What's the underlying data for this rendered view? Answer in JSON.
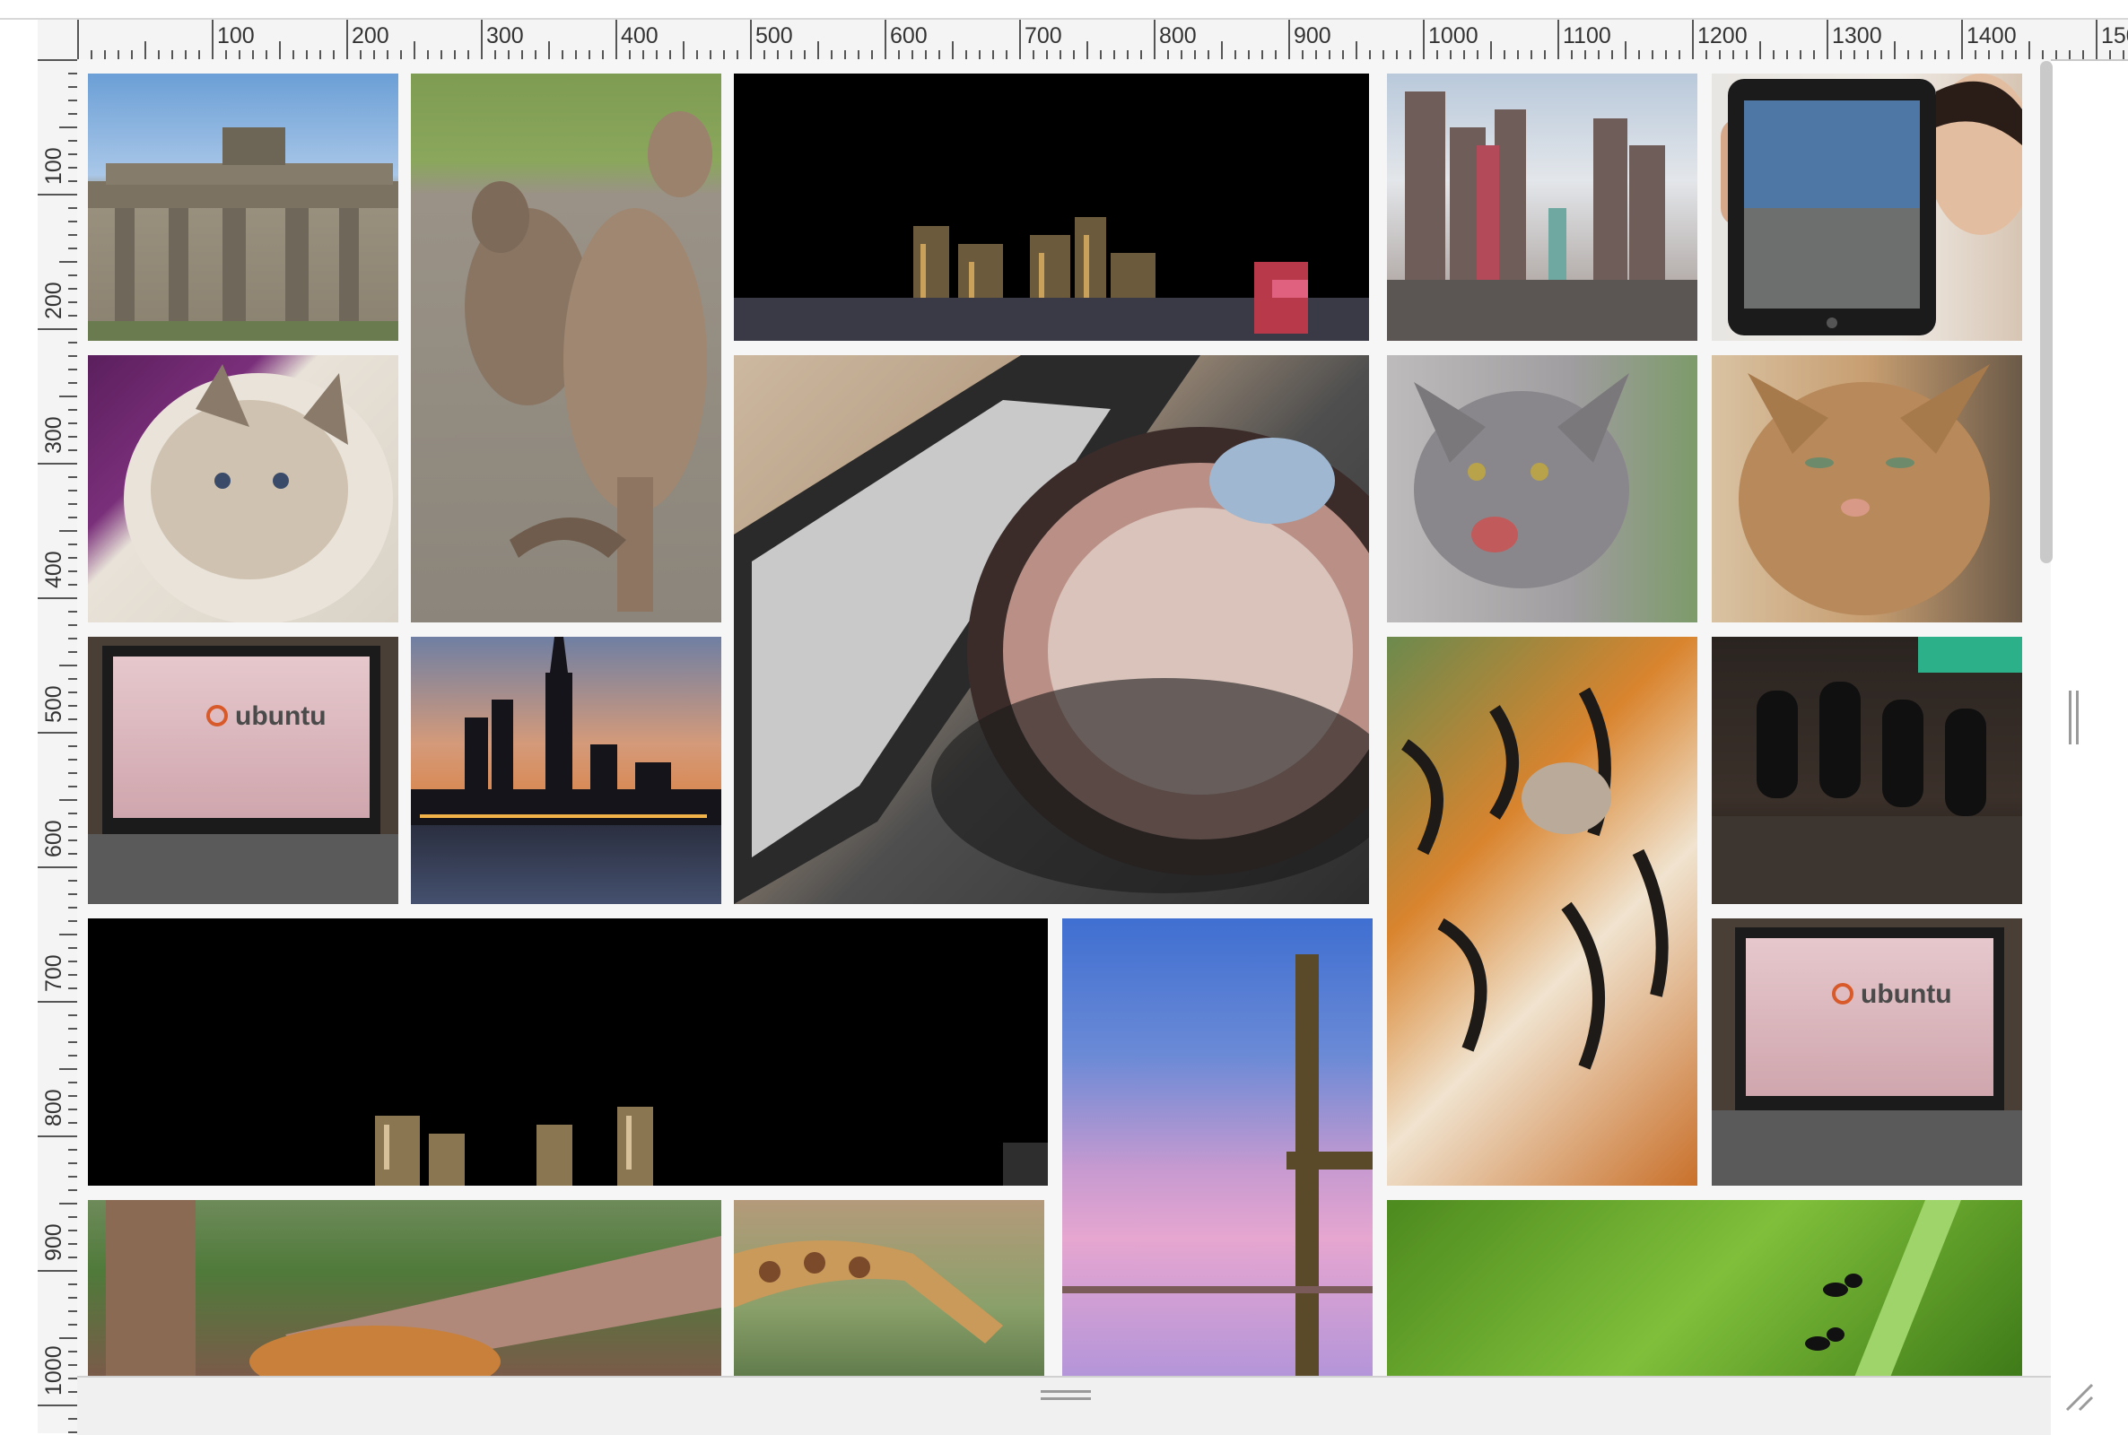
{
  "ruler": {
    "horizontal_labels": [
      "100",
      "200",
      "300",
      "400",
      "500",
      "600",
      "700",
      "800",
      "900",
      "1000",
      "1100",
      "1200",
      "1300",
      "1400",
      "150"
    ],
    "vertical_labels": [
      "100",
      "200",
      "300",
      "400",
      "500",
      "600",
      "700",
      "800",
      "900",
      "1000"
    ]
  },
  "gallery": {
    "tiles": [
      {
        "name": "brandenburg-gate-photo",
        "subject": "Brandenburg Gate"
      },
      {
        "name": "kangaroos-photo",
        "subject": "Kangaroos"
      },
      {
        "name": "las-vegas-night-skyline-photo",
        "subject": "Las Vegas skyline at night"
      },
      {
        "name": "new-york-new-york-casino-photo",
        "subject": "New York-New York casino"
      },
      {
        "name": "ipad-held-by-man-photo",
        "subject": "Man holding iPad"
      },
      {
        "name": "birman-cat-photo",
        "subject": "White long-haired cat"
      },
      {
        "name": "turntable-photo",
        "subject": "DJ turntable and mixer"
      },
      {
        "name": "hissing-gray-cat-photo",
        "subject": "Hissing gray cat"
      },
      {
        "name": "tabby-cat-photo",
        "subject": "Orange tabby cat"
      },
      {
        "name": "ubuntu-laptop-photo",
        "subject": "Laptop with Ubuntu screen",
        "caption": "ubuntu"
      },
      {
        "name": "empire-state-sunset-photo",
        "subject": "Manhattan skyline at dusk"
      },
      {
        "name": "tiger-closeup-photo",
        "subject": "Tiger close-up"
      },
      {
        "name": "circuit-board-capacitors-photo",
        "subject": "Circuit board capacitors"
      },
      {
        "name": "las-vegas-night-wide-photo",
        "subject": "Las Vegas skyline at night, wide"
      },
      {
        "name": "wooden-post-sunset-photo",
        "subject": "Wooden post at sunset"
      },
      {
        "name": "ubuntu-laptop-photo-2",
        "subject": "Laptop with Ubuntu screen",
        "caption": "ubuntu"
      },
      {
        "name": "tiger-statue-photo",
        "subject": "Tiger lying by statue"
      },
      {
        "name": "giraffe-photo",
        "subject": "Giraffe grazing"
      },
      {
        "name": "ants-on-grass-photo",
        "subject": "Ants on green grass"
      }
    ]
  }
}
